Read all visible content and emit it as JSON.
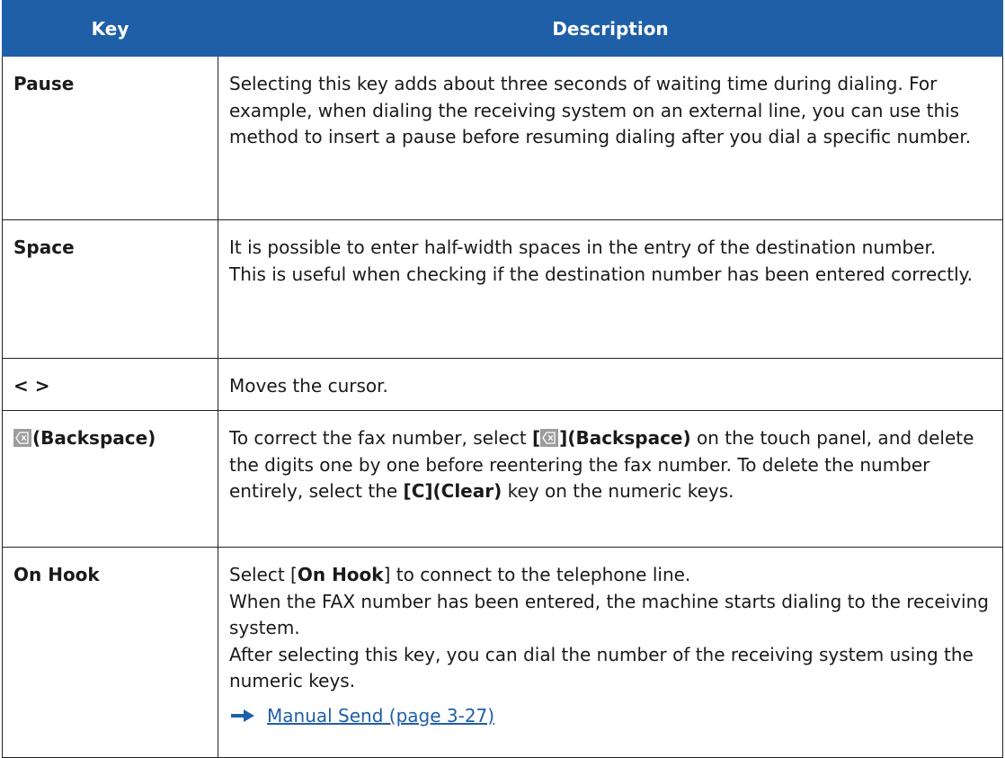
{
  "header": {
    "key": "Key",
    "description": "Description"
  },
  "rows": [
    {
      "key": "Pause",
      "description": "Selecting this key adds about three seconds of waiting time during dialing. For example, when dialing the receiving system on an external line, you can use this method to insert a pause before resuming dialing after you dial a specific number."
    },
    {
      "key": "Space",
      "lines": [
        "It is possible to enter half-width spaces in the entry of the destination number.",
        "This is useful when checking if the destination number has been entered correctly."
      ]
    },
    {
      "key": "< >",
      "description": "Moves the cursor."
    },
    {
      "key": "(Backspace)",
      "desc": {
        "p1": "To correct the fax number, select ",
        "bracket_open": "[",
        "bracket_close": "](Backspace)",
        "p2": " on the touch panel, and delete the digits one by one before reentering the fax number. To delete the number entirely, select the ",
        "bold2": "[C](Clear)",
        "p3": " key on the numeric keys."
      }
    },
    {
      "key": "On Hook",
      "desc": {
        "l1_pre": "Select [",
        "l1_bold": "On Hook",
        "l1_post": "] to connect to the telephone line.",
        "l2": "When the FAX number has been entered, the machine starts dialing to the receiving system.",
        "l3": "After selecting this key, you can dial the number of the receiving system using the numeric keys.",
        "link": "Manual Send (page 3-27)"
      }
    }
  ],
  "colors": {
    "header_bg": "#1f5fa8",
    "link": "#1f5fa8",
    "icon_bg": "#9c9c9c"
  },
  "icons": {
    "backspace": "backspace-icon",
    "arrow": "arrow-right-icon"
  }
}
